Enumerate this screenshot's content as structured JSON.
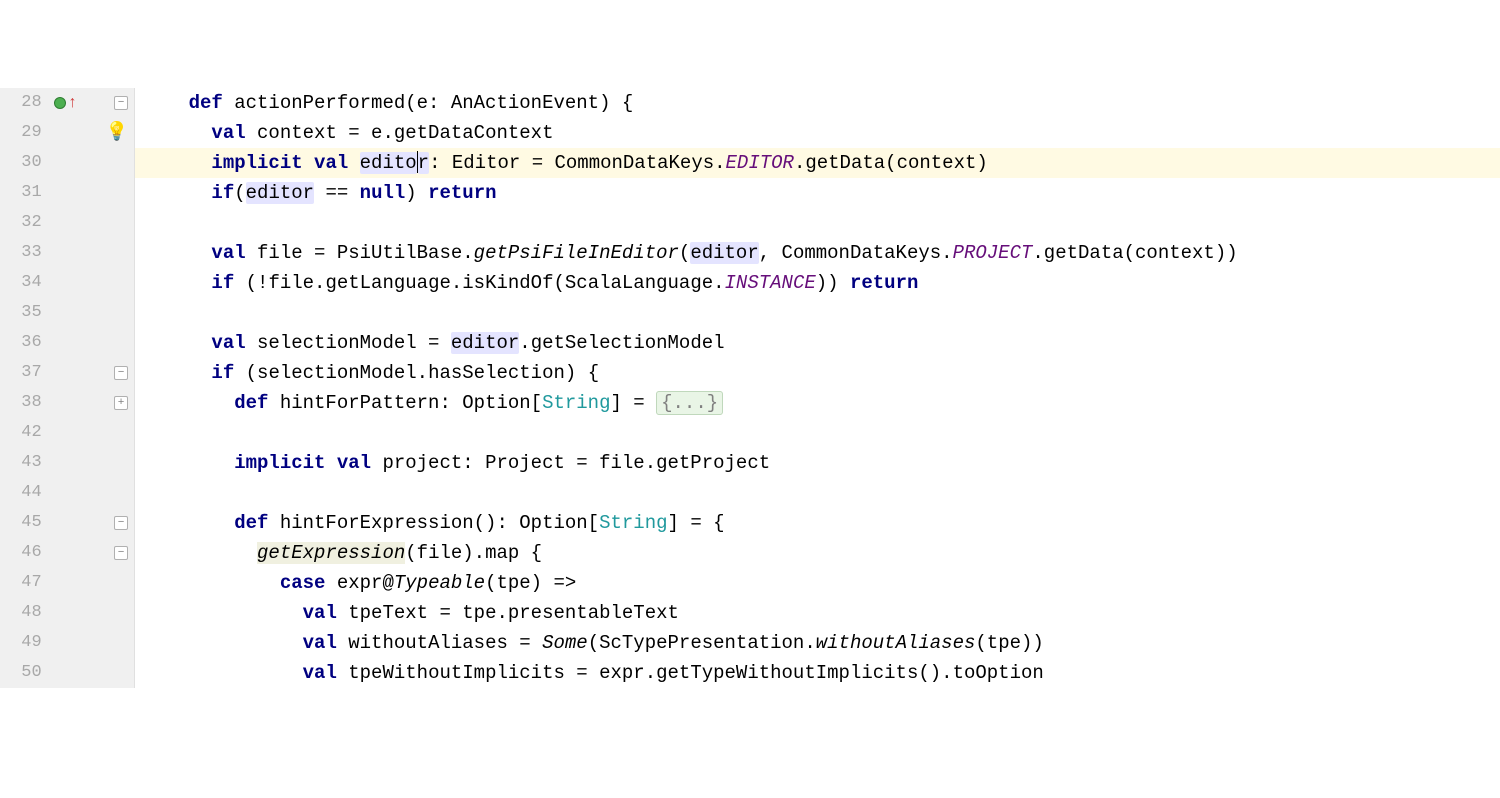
{
  "lines": {
    "28": {
      "no": "28",
      "indent": "    ",
      "tokens": [
        {
          "t": "def ",
          "c": "kw"
        },
        {
          "t": "actionPerformed(e: AnActionEvent) {"
        }
      ],
      "vcs": true,
      "upArrow": true,
      "foldMinus": true
    },
    "29": {
      "no": "29",
      "indent": "      ",
      "tokens": [
        {
          "t": "val ",
          "c": "kw"
        },
        {
          "t": "context = e.getDataContext"
        }
      ],
      "bulb": true
    },
    "30": {
      "no": "30",
      "indent": "      ",
      "highlight": true,
      "tokens": [
        {
          "t": "implicit val ",
          "c": "kw"
        },
        {
          "t": "edito",
          "c": "usage-hl"
        },
        {
          "caret": true
        },
        {
          "t": "r",
          "c": "usage-hl"
        },
        {
          "t": ": Editor = CommonDataKeys."
        },
        {
          "t": "EDITOR",
          "c": "ital-static"
        },
        {
          "t": ".getData(context)"
        }
      ]
    },
    "31": {
      "no": "31",
      "indent": "      ",
      "tokens": [
        {
          "t": "if",
          "c": "kw"
        },
        {
          "t": "("
        },
        {
          "t": "editor",
          "c": "usage-hl"
        },
        {
          "t": " == "
        },
        {
          "t": "null",
          "c": "kw"
        },
        {
          "t": ") "
        },
        {
          "t": "return",
          "c": "kw"
        }
      ]
    },
    "32": {
      "no": "32",
      "indent": "",
      "tokens": [
        {
          "t": ""
        }
      ]
    },
    "33": {
      "no": "33",
      "indent": "      ",
      "tokens": [
        {
          "t": "val ",
          "c": "kw"
        },
        {
          "t": "file = PsiUtilBase."
        },
        {
          "t": "getPsiFileInEditor",
          "c": "method-ital"
        },
        {
          "t": "("
        },
        {
          "t": "editor",
          "c": "usage-hl"
        },
        {
          "t": ", CommonDataKeys."
        },
        {
          "t": "PROJECT",
          "c": "ital-static"
        },
        {
          "t": ".getData(context))"
        }
      ]
    },
    "34": {
      "no": "34",
      "indent": "      ",
      "tokens": [
        {
          "t": "if ",
          "c": "kw"
        },
        {
          "t": "(!file.getLanguage.isKindOf(ScalaLanguage."
        },
        {
          "t": "INSTANCE",
          "c": "ital-static"
        },
        {
          "t": ")) "
        },
        {
          "t": "return",
          "c": "kw"
        }
      ]
    },
    "35": {
      "no": "35",
      "indent": "",
      "tokens": [
        {
          "t": ""
        }
      ]
    },
    "36": {
      "no": "36",
      "indent": "      ",
      "tokens": [
        {
          "t": "val ",
          "c": "kw"
        },
        {
          "t": "selectionModel = "
        },
        {
          "t": "editor",
          "c": "usage-hl"
        },
        {
          "t": ".getSelectionModel"
        }
      ]
    },
    "37": {
      "no": "37",
      "indent": "      ",
      "tokens": [
        {
          "t": "if ",
          "c": "kw"
        },
        {
          "t": "(selectionModel.hasSelection) {"
        }
      ],
      "foldMinus": true
    },
    "38": {
      "no": "38",
      "indent": "        ",
      "tokens": [
        {
          "t": "def ",
          "c": "kw"
        },
        {
          "t": "hintForPattern: Option["
        },
        {
          "t": "String",
          "c": "teal"
        },
        {
          "t": "] = "
        },
        {
          "t": "{...}",
          "folded": true
        }
      ],
      "foldPlus": true
    },
    "42": {
      "no": "42",
      "indent": "",
      "tokens": [
        {
          "t": ""
        }
      ]
    },
    "43": {
      "no": "43",
      "indent": "        ",
      "tokens": [
        {
          "t": "implicit val ",
          "c": "kw"
        },
        {
          "t": "project: Project = file.getProject"
        }
      ]
    },
    "44": {
      "no": "44",
      "indent": "",
      "tokens": [
        {
          "t": ""
        }
      ]
    },
    "45": {
      "no": "45",
      "indent": "        ",
      "tokens": [
        {
          "t": "def ",
          "c": "kw"
        },
        {
          "t": "hintForExpression(): Option["
        },
        {
          "t": "String",
          "c": "teal"
        },
        {
          "t": "] = {"
        }
      ],
      "foldMinus": true
    },
    "46": {
      "no": "46",
      "indent": "          ",
      "tokens": [
        {
          "t": "getExpression",
          "c": "method-ital warn-ul"
        },
        {
          "t": "(file).map {"
        }
      ],
      "foldMinus": true
    },
    "47": {
      "no": "47",
      "indent": "            ",
      "tokens": [
        {
          "t": "case ",
          "c": "kw"
        },
        {
          "t": "expr@"
        },
        {
          "t": "Typeable",
          "c": "method-ital"
        },
        {
          "t": "(tpe) =>"
        }
      ]
    },
    "48": {
      "no": "48",
      "indent": "              ",
      "tokens": [
        {
          "t": "val ",
          "c": "kw"
        },
        {
          "t": "tpeText = tpe.presentableText"
        }
      ]
    },
    "49": {
      "no": "49",
      "indent": "              ",
      "tokens": [
        {
          "t": "val ",
          "c": "kw"
        },
        {
          "t": "withoutAliases = "
        },
        {
          "t": "Some",
          "c": "method-ital"
        },
        {
          "t": "(ScTypePresentation."
        },
        {
          "t": "withoutAliases",
          "c": "method-ital"
        },
        {
          "t": "(tpe))"
        }
      ]
    },
    "50": {
      "no": "50",
      "indent": "              ",
      "tokens": [
        {
          "t": "val ",
          "c": "kw"
        },
        {
          "t": "tpeWithoutImplicits = expr."
        },
        {
          "t": "getTypeWithoutImplicits",
          "c": ""
        },
        {
          "t": "().toOption"
        }
      ]
    }
  },
  "order": [
    "28",
    "29",
    "30",
    "31",
    "32",
    "33",
    "34",
    "35",
    "36",
    "37",
    "38",
    "42",
    "43",
    "44",
    "45",
    "46",
    "47",
    "48",
    "49",
    "50"
  ],
  "tabSize": 2,
  "baseIndentPx": 28
}
